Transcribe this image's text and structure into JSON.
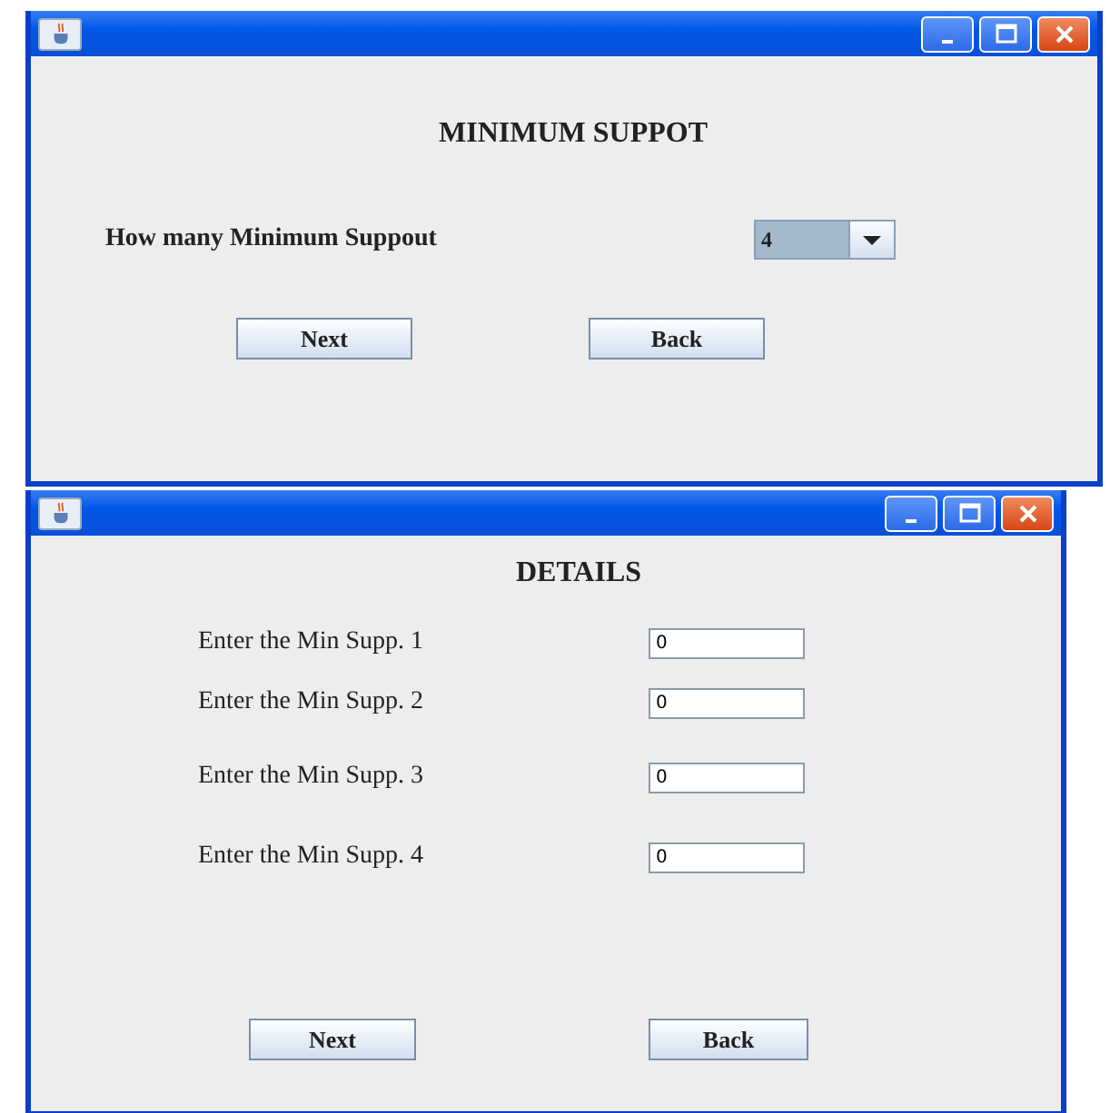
{
  "windows": [
    {
      "kind": "chooser",
      "heading": "MINIMUM SUPPOT",
      "prompt": "How many Minimum Suppout",
      "combo_value": "4",
      "buttons": [
        "Next",
        "Back"
      ]
    },
    {
      "kind": "details",
      "heading": "DETAILS",
      "fields": [
        {
          "label": "Enter the Min Supp. 1",
          "value": "0"
        },
        {
          "label": "Enter the Min Supp. 2",
          "value": "0"
        },
        {
          "label": "Enter the Min Supp. 3",
          "value": "0"
        },
        {
          "label": "Enter the Min Supp. 4",
          "value": "0"
        }
      ],
      "buttons": [
        "Next",
        "Back"
      ]
    }
  ]
}
